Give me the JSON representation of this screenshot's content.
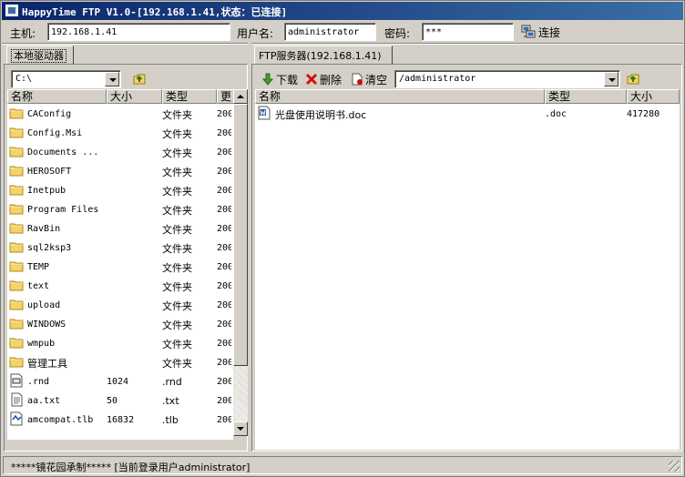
{
  "window": {
    "title": "HappyTime FTP V1.0-[192.168.1.41,状态：已连接]"
  },
  "connection": {
    "host_label": "主机:",
    "host_value": "192.168.1.41",
    "user_label": "用户名:",
    "user_value": "administrator",
    "password_label": "密码:",
    "password_value": "***",
    "connect_label": "连接"
  },
  "local": {
    "tab_label": "本地驱动器",
    "drive_value": "C:\\",
    "columns": [
      "名称",
      "大小",
      "类型",
      "更"
    ],
    "files": [
      {
        "name": "CAConfig",
        "size": "",
        "type": "文件夹",
        "date": "200",
        "icon": "folder-icon"
      },
      {
        "name": "Config.Msi",
        "size": "",
        "type": "文件夹",
        "date": "200",
        "icon": "folder-icon"
      },
      {
        "name": "Documents ...",
        "size": "",
        "type": "文件夹",
        "date": "200",
        "icon": "folder-icon"
      },
      {
        "name": "HEROSOFT",
        "size": "",
        "type": "文件夹",
        "date": "200",
        "icon": "folder-icon"
      },
      {
        "name": "Inetpub",
        "size": "",
        "type": "文件夹",
        "date": "200",
        "icon": "folder-icon"
      },
      {
        "name": "Program Files",
        "size": "",
        "type": "文件夹",
        "date": "200",
        "icon": "folder-icon"
      },
      {
        "name": "RavBin",
        "size": "",
        "type": "文件夹",
        "date": "200",
        "icon": "folder-icon"
      },
      {
        "name": "sql2ksp3",
        "size": "",
        "type": "文件夹",
        "date": "200",
        "icon": "folder-icon"
      },
      {
        "name": "TEMP",
        "size": "",
        "type": "文件夹",
        "date": "200",
        "icon": "folder-icon"
      },
      {
        "name": "text",
        "size": "",
        "type": "文件夹",
        "date": "200",
        "icon": "folder-icon"
      },
      {
        "name": "upload",
        "size": "",
        "type": "文件夹",
        "date": "200",
        "icon": "folder-icon"
      },
      {
        "name": "WINDOWS",
        "size": "",
        "type": "文件夹",
        "date": "200",
        "icon": "folder-icon"
      },
      {
        "name": "wmpub",
        "size": "",
        "type": "文件夹",
        "date": "200",
        "icon": "folder-icon"
      },
      {
        "name": "管理工具",
        "size": "",
        "type": "文件夹",
        "date": "200",
        "icon": "folder-icon"
      },
      {
        "name": ".rnd",
        "size": "1024",
        "type": ".rnd",
        "date": "200",
        "icon": "rnd-file-icon"
      },
      {
        "name": "aa.txt",
        "size": "50",
        "type": ".txt",
        "date": "200",
        "icon": "text-file-icon"
      },
      {
        "name": "amcompat.tlb",
        "size": "16832",
        "type": ".tlb",
        "date": "200",
        "icon": "tlb-file-icon"
      }
    ]
  },
  "remote": {
    "tab_label": "FTP服务器(192.168.1.41)",
    "download_label": "下载",
    "delete_label": "删除",
    "clear_label": "清空",
    "path_value": "/administrator",
    "columns": [
      "名称",
      "类型",
      "大小"
    ],
    "files": [
      {
        "name": "光盘使用说明书.doc",
        "type": ".doc",
        "size": "417280",
        "icon": "word-doc-icon"
      }
    ]
  },
  "status": {
    "text": "*****镜花园承制***** [当前登录用户administrator]"
  }
}
